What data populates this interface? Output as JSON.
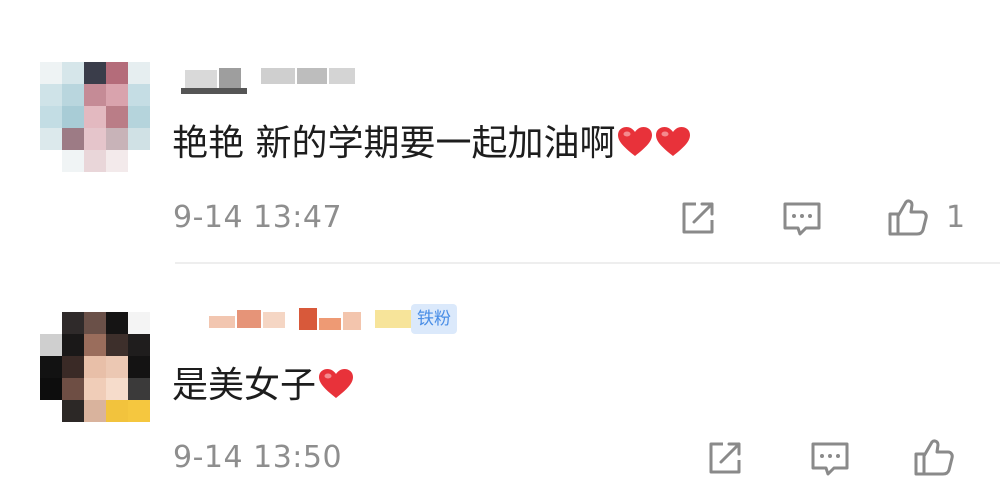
{
  "comments": [
    {
      "text": "艳艳 新的学期要一起加油啊",
      "hearts": 2,
      "timestamp": "9-14 13:47",
      "like_count": "1",
      "icons": [
        "forward-icon",
        "comment-icon",
        "thumbs-up-icon",
        "heart-icon"
      ]
    },
    {
      "text": "是美女子",
      "hearts": 1,
      "badge": "铁粉",
      "timestamp": "9-14 13:50",
      "like_count": "",
      "icons": [
        "forward-icon",
        "comment-icon",
        "thumbs-up-icon",
        "heart-icon"
      ]
    }
  ],
  "colors": {
    "heart": "#e8323a",
    "meta_gray": "#8e8e8e",
    "badge_bg": "#dbe9fb",
    "badge_text": "#4a8ee6"
  }
}
